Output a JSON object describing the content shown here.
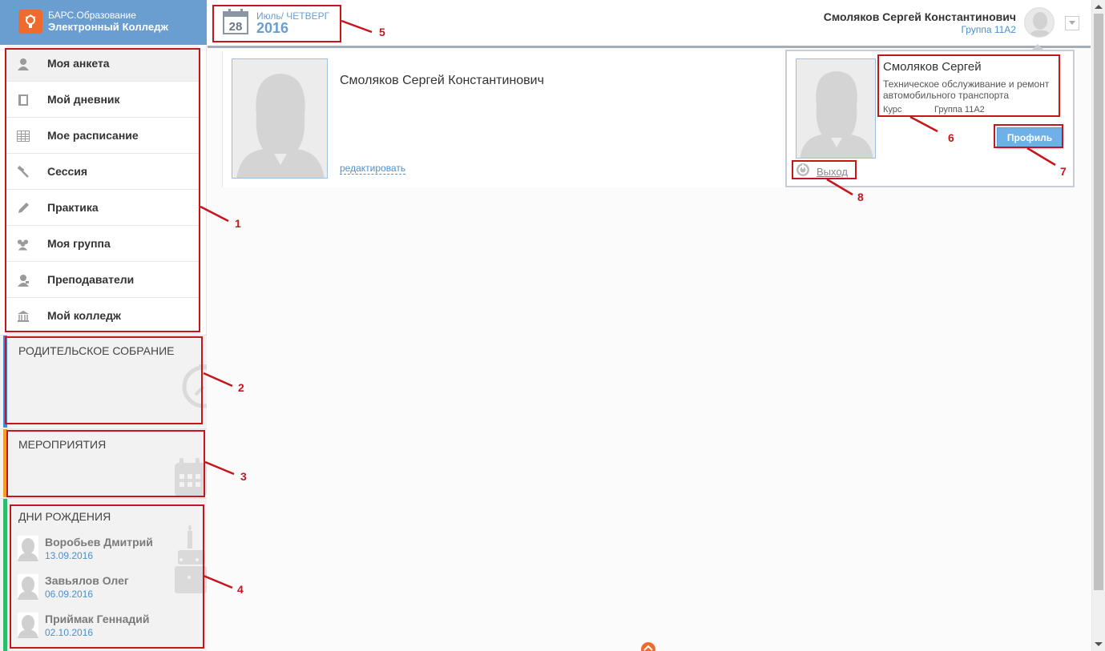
{
  "logo": {
    "line1": "БАРС.Образование",
    "line2": "Электронный Колледж",
    "icon": "bars-logo-icon"
  },
  "menu": [
    {
      "label": "Моя анкета",
      "icon": "user-icon",
      "active": true
    },
    {
      "label": "Мой дневник",
      "icon": "diary-icon"
    },
    {
      "label": "Мое расписание",
      "icon": "schedule-grid-icon"
    },
    {
      "label": "Сессия",
      "icon": "hammer-icon"
    },
    {
      "label": "Практика",
      "icon": "pencil-icon"
    },
    {
      "label": "Моя группа",
      "icon": "group-icon"
    },
    {
      "label": "Преподаватели",
      "icon": "teacher-icon"
    },
    {
      "label": "Мой колледж",
      "icon": "college-building-icon"
    }
  ],
  "widgets": {
    "parents": {
      "title": "РОДИТЕЛЬСКОЕ СОБРАНИЕ",
      "color": "#3a8fd6",
      "icon": "clock-icon"
    },
    "events": {
      "title": "МЕРОПРИЯТИЯ",
      "color": "#f0a020",
      "icon": "calendar-icon"
    },
    "birthdays": {
      "title": "ДНИ РОЖДЕНИЯ",
      "color": "#2dbb6e",
      "icon": "cake-icon"
    }
  },
  "birthdays": [
    {
      "name": "Воробьев Дмитрий",
      "date": "13.09.2016"
    },
    {
      "name": "Завьялов Олег",
      "date": "06.09.2016"
    },
    {
      "name": "Приймак Геннадий",
      "date": "02.10.2016"
    }
  ],
  "header": {
    "day": "28",
    "month_weekday": "Июль/ ЧЕТВЕРГ",
    "year": "2016",
    "user_name": "Смоляков Сергей Константинович",
    "user_group": "Группа 11А2"
  },
  "card": {
    "name": "Смоляков Сергей Константинович",
    "edit_label": "редактировать"
  },
  "popup": {
    "name": "Смоляков Сергей",
    "specialty": "Техническое обслуживание и ремонт автомобильного транспорта",
    "course": "Курс",
    "group": "Группа 11А2",
    "profile_button": "Профиль",
    "exit_label": "Выход"
  },
  "callouts": [
    "1",
    "2",
    "3",
    "4",
    "5",
    "6",
    "7",
    "8"
  ],
  "colors": {
    "accent_blue": "#6a9ed0",
    "link_blue": "#4b8fcf",
    "annotation_red": "#c4161c",
    "logo_orange": "#ef6b2d"
  }
}
